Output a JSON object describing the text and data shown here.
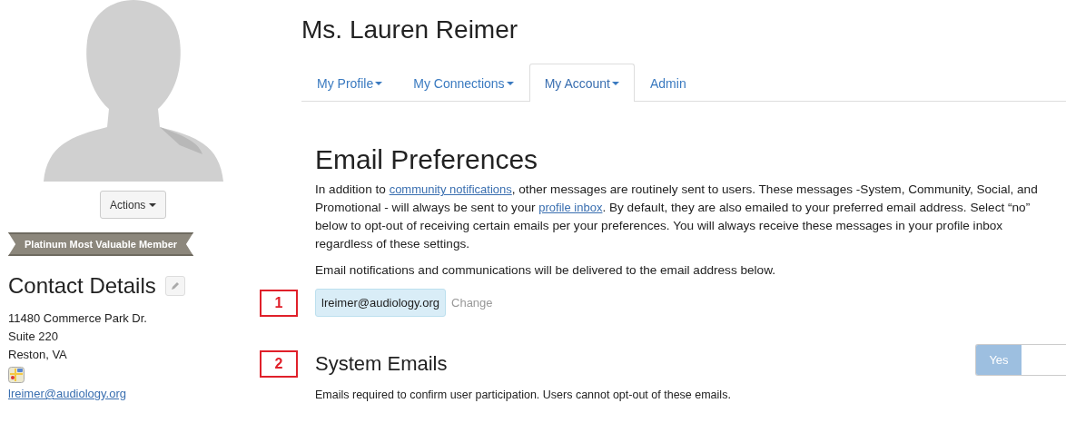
{
  "profile": {
    "actions_button": "Actions",
    "badge": "Platinum Most Valuable Member",
    "contact_heading": "Contact Details",
    "address": [
      "11480 Commerce Park Dr.",
      "Suite 220",
      "Reston, VA"
    ],
    "email": "lreimer@audiology.org"
  },
  "title": "Ms. Lauren Reimer",
  "tabs": [
    {
      "label": "My Profile",
      "dropdown": true,
      "selected": false
    },
    {
      "label": "My Connections",
      "dropdown": true,
      "selected": false
    },
    {
      "label": "My Account",
      "dropdown": true,
      "selected": true
    },
    {
      "label": "Admin",
      "dropdown": false,
      "selected": false
    }
  ],
  "section": {
    "heading": "Email Preferences",
    "intro": [
      {
        "kind": "text",
        "text": "In addition to "
      },
      {
        "kind": "link",
        "text": "community notifications"
      },
      {
        "kind": "text",
        "text": ", other messages are routinely sent to users. These messages -System, Community, Social, and Promotional - will always be sent to your "
      },
      {
        "kind": "link",
        "text": "profile inbox"
      },
      {
        "kind": "text",
        "text": ". By default, they are also emailed to your preferred email address. Select “no” below to opt-out of receiving certain emails per your preferences. You will always receive these messages in your profile inbox regardless of these settings."
      }
    ],
    "delivery_note": "Email notifications and communications will be delivered to the email address below.",
    "email": "lreimer@audiology.org",
    "change_link": "Change",
    "email_marker": "1",
    "system": {
      "marker": "2",
      "heading": "System Emails",
      "toggle": {
        "label": "Yes",
        "on": true
      },
      "description": "Emails required to confirm user participation. Users cannot opt-out of these emails."
    }
  }
}
